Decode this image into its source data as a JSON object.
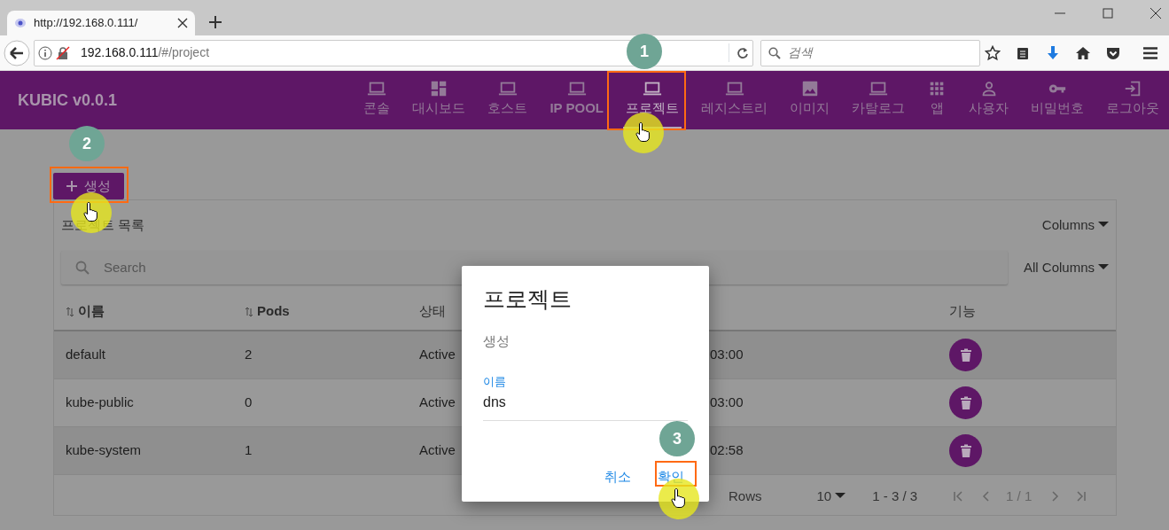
{
  "browser": {
    "tab_title": "http://192.168.0.111/",
    "url_host": "192.168.0.111",
    "url_path": "/#/project",
    "search_placeholder": "검색"
  },
  "app": {
    "brand": "KUBIC v0.0.1",
    "nav": [
      {
        "label": "콘솔",
        "kind": "laptop",
        "selected": false
      },
      {
        "label": "대시보드",
        "kind": "dashboard",
        "selected": false
      },
      {
        "label": "호스트",
        "kind": "laptop",
        "selected": false
      },
      {
        "label": "IP POOL",
        "kind": "laptop",
        "selected": false
      },
      {
        "label": "프로젝트",
        "kind": "laptop",
        "selected": true
      },
      {
        "label": "레지스트리",
        "kind": "laptop",
        "selected": false
      },
      {
        "label": "이미지",
        "kind": "image",
        "selected": false
      },
      {
        "label": "카탈로그",
        "kind": "laptop",
        "selected": false
      },
      {
        "label": "앱",
        "kind": "apps",
        "selected": false
      },
      {
        "label": "사용자",
        "kind": "person",
        "selected": false
      },
      {
        "label": "비밀번호",
        "kind": "key",
        "selected": false
      },
      {
        "label": "로그아웃",
        "kind": "exit",
        "selected": false
      }
    ]
  },
  "create_button": {
    "label": "생성"
  },
  "table_card": {
    "title": "프로젝트 목록",
    "columns_menu": "Columns",
    "search_placeholder": "Search",
    "filter_menu": "All Columns",
    "columns": [
      {
        "label": "이름",
        "sortable": true
      },
      {
        "label": "Pods",
        "sortable": true
      },
      {
        "label": "상태",
        "sortable": false
      },
      {
        "label": "기능",
        "sortable": false
      }
    ],
    "rows": [
      {
        "name": "default",
        "pods": "2",
        "status": "Active",
        "column_4": "03:00"
      },
      {
        "name": "kube-public",
        "pods": "0",
        "status": "Active",
        "column_4": "03:00"
      },
      {
        "name": "kube-system",
        "pods": "1",
        "status": "Active",
        "column_4": "02:58"
      }
    ],
    "footer": {
      "rows_label": "Rows",
      "page_size": "10",
      "range": "1 - 3 / 3",
      "page": "1 / 1"
    }
  },
  "modal": {
    "title": "프로젝트",
    "subtitle": "생성",
    "field_label": "이름",
    "field_value": "dns",
    "buttons": [
      {
        "label": "취소"
      },
      {
        "label": "확인"
      }
    ]
  },
  "steps": [
    {
      "number": "1"
    },
    {
      "number": "2"
    },
    {
      "number": "3"
    }
  ]
}
